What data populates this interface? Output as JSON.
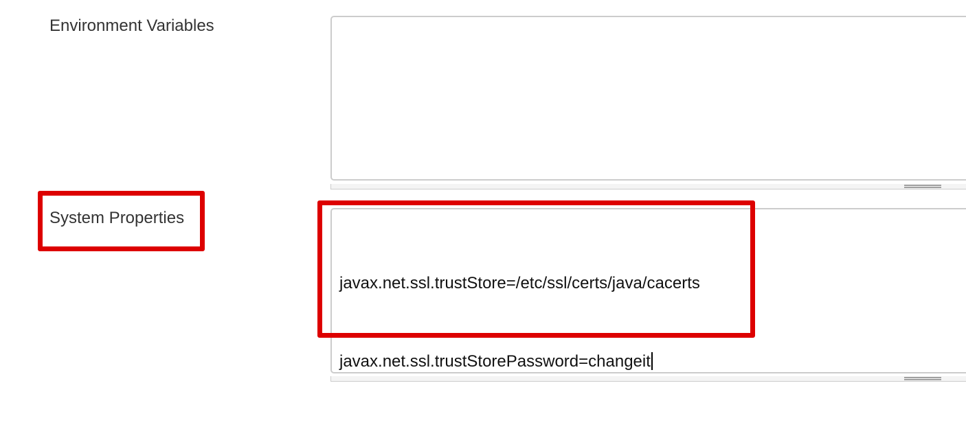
{
  "form": {
    "environment_variables": {
      "label": "Environment Variables",
      "value": ""
    },
    "system_properties": {
      "label": "System Properties",
      "value_lines": [
        "javax.net.ssl.trustStore=/etc/ssl/certs/java/cacerts",
        "javax.net.ssl.trustStorePassword=changeit"
      ]
    }
  },
  "colors": {
    "highlight": "#dd0000",
    "textarea_border": "#cccccc",
    "label_text": "#333333"
  }
}
